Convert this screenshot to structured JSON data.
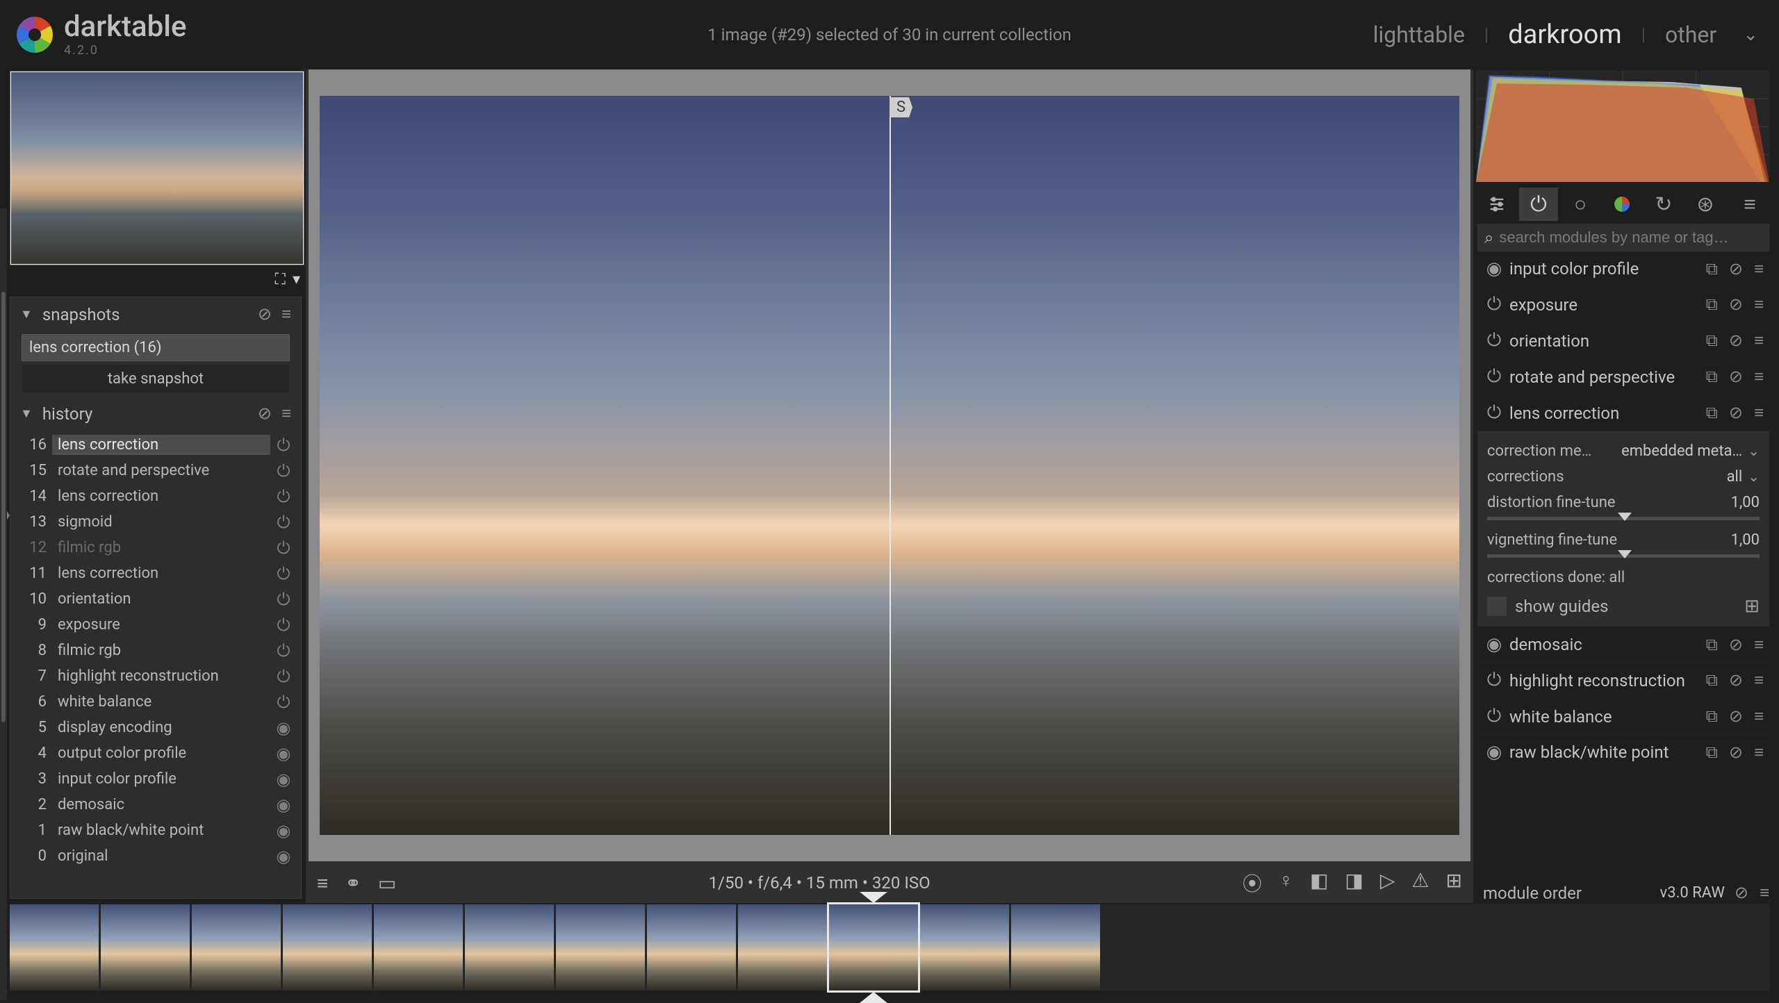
{
  "brand": {
    "name": "darktable",
    "version": "4.2.0"
  },
  "header": {
    "status": "1 image (#29) selected of 30 in current collection",
    "views": {
      "lighttable": "lighttable",
      "darkroom": "darkroom",
      "other": "other"
    }
  },
  "left": {
    "snapshots": {
      "title": "snapshots",
      "item": "lens correction (16)",
      "take": "take snapshot"
    },
    "history": {
      "title": "history",
      "items": [
        {
          "num": "16",
          "label": "lens correction",
          "icon": "power",
          "selected": true
        },
        {
          "num": "15",
          "label": "rotate and perspective",
          "icon": "power"
        },
        {
          "num": "14",
          "label": "lens correction",
          "icon": "power"
        },
        {
          "num": "13",
          "label": "sigmoid",
          "icon": "power"
        },
        {
          "num": "12",
          "label": "filmic rgb",
          "icon": "power",
          "dim": true
        },
        {
          "num": "11",
          "label": "lens correction",
          "icon": "power"
        },
        {
          "num": "10",
          "label": "orientation",
          "icon": "power"
        },
        {
          "num": "9",
          "label": "exposure",
          "icon": "power"
        },
        {
          "num": "8",
          "label": "filmic rgb",
          "icon": "power"
        },
        {
          "num": "7",
          "label": "highlight reconstruction",
          "icon": "power"
        },
        {
          "num": "6",
          "label": "white balance",
          "icon": "power"
        },
        {
          "num": "5",
          "label": "display encoding",
          "icon": "target"
        },
        {
          "num": "4",
          "label": "output color profile",
          "icon": "target"
        },
        {
          "num": "3",
          "label": "input color profile",
          "icon": "target"
        },
        {
          "num": "2",
          "label": "demosaic",
          "icon": "target"
        },
        {
          "num": "1",
          "label": "raw black/white point",
          "icon": "target"
        },
        {
          "num": "0",
          "label": "original",
          "icon": "target"
        }
      ]
    }
  },
  "center": {
    "split_tag": "S",
    "info": "1/50 • f/6,4 • 15 mm • 320 ISO"
  },
  "right": {
    "search_placeholder": "search modules by name or tag…",
    "modules": [
      {
        "name": "input color profile",
        "pwr": "target"
      },
      {
        "name": "exposure",
        "pwr": "power"
      },
      {
        "name": "orientation",
        "pwr": "power"
      },
      {
        "name": "rotate and perspective",
        "pwr": "power"
      },
      {
        "name": "lens correction",
        "pwr": "power",
        "expanded": true
      },
      {
        "name": "demosaic",
        "pwr": "target"
      },
      {
        "name": "highlight reconstruction",
        "pwr": "power"
      },
      {
        "name": "white balance",
        "pwr": "power"
      },
      {
        "name": "raw black/white point",
        "pwr": "target"
      }
    ],
    "lens": {
      "method_label": "correction me…",
      "method_value": "embedded meta…",
      "corrections_label": "corrections",
      "corrections_value": "all",
      "distortion_label": "distortion fine-tune",
      "distortion_value": "1,00",
      "vignetting_label": "vignetting fine-tune",
      "vignetting_value": "1,00",
      "done": "corrections done: all",
      "show_guides": "show guides"
    },
    "module_order": {
      "label": "module order",
      "value": "v3.0 RAW"
    }
  },
  "colors": {
    "accent_red": "#d54028",
    "accent_green": "#5fb83b",
    "accent_blue": "#3a6de0",
    "accent_yellow": "#e2cc2c"
  }
}
